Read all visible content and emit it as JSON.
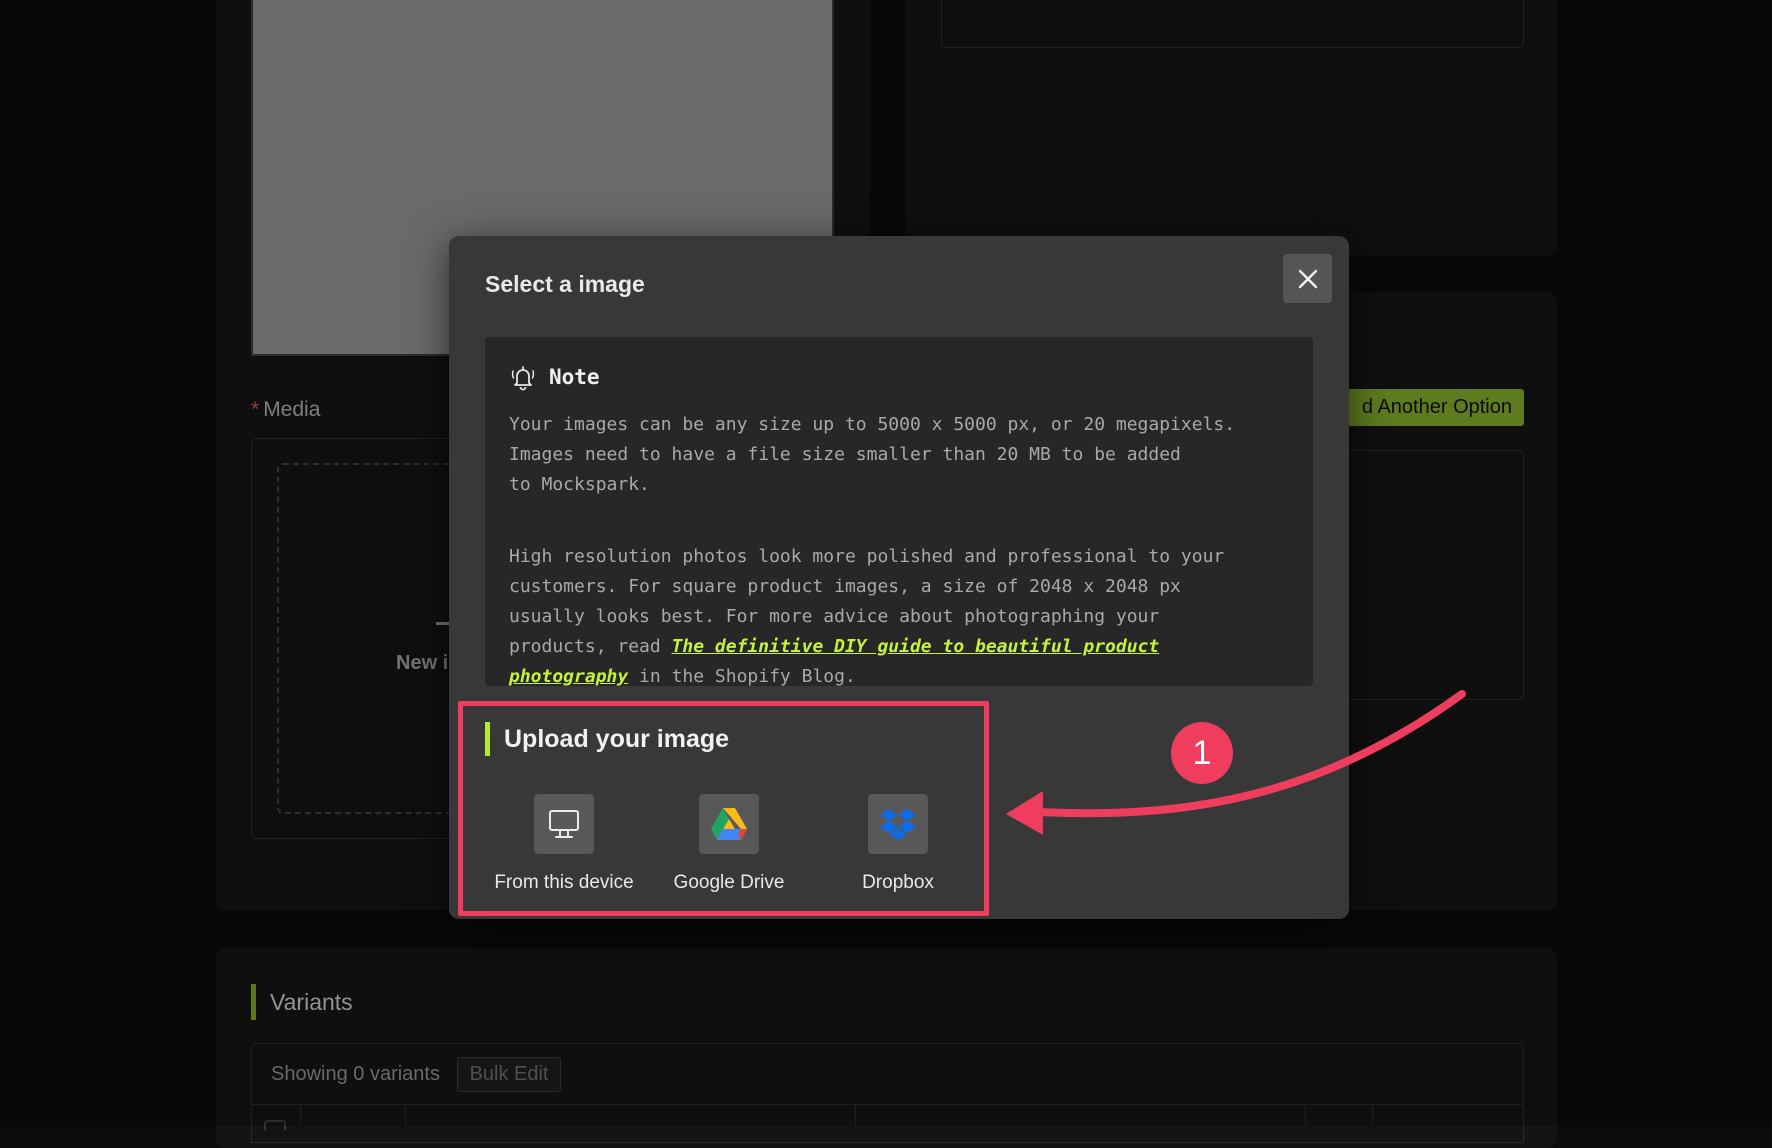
{
  "background": {
    "media": {
      "required_mark": "*",
      "label": "Media",
      "new_image_text": "New i"
    },
    "options": {
      "add_option_label": "d Another Option"
    },
    "variants": {
      "title": "Variants",
      "showing_text": "Showing 0 variants",
      "bulk_edit_label": "Bulk Edit"
    }
  },
  "modal": {
    "title": "Select a image",
    "close_icon": "close-icon",
    "note": {
      "icon": "bell-icon",
      "heading": "Note",
      "paragraph1": "Your images can be any size up to 5000 x 5000 px, or 20 megapixels.\nImages need to have a file size smaller than 20 MB to be added\nto Mockspark.",
      "paragraph2_before": "High resolution photos look more polished and professional to your\ncustomers. For square product images, a size of 2048 x 2048 px\nusually looks best. For more advice about photographing your\nproducts, read ",
      "paragraph2_link": "The definitive DIY guide to beautiful product\nphotography",
      "paragraph2_after": " in the Shopify Blog."
    },
    "upload": {
      "title": "Upload your image",
      "sources": [
        {
          "label": "From this device",
          "icon": "monitor-icon"
        },
        {
          "label": "Google Drive",
          "icon": "google-drive-icon"
        },
        {
          "label": "Dropbox",
          "icon": "dropbox-icon"
        }
      ]
    }
  },
  "annotation": {
    "badge_number": "1",
    "color": "#ef3d5e"
  },
  "colors": {
    "accent_green": "#b7ea2c",
    "annotation_pink": "#ef3d5e",
    "modal_bg": "#383838"
  }
}
